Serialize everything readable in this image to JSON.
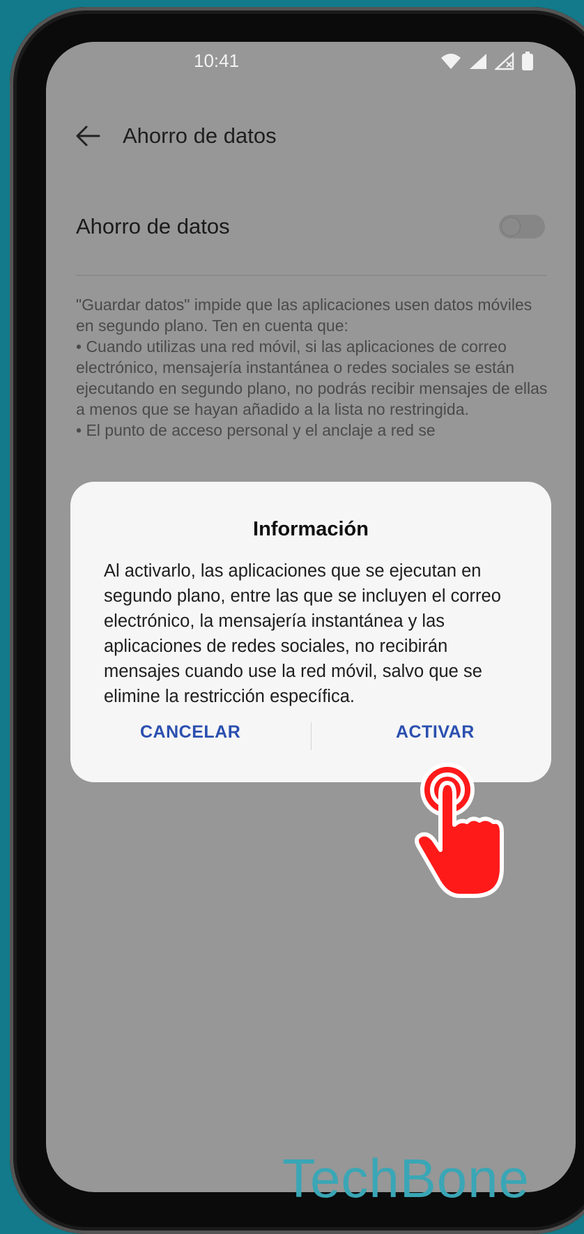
{
  "status_bar": {
    "time": "10:41",
    "icons": [
      "wifi-icon",
      "signal-icon",
      "signal-no-service-icon",
      "battery-icon"
    ]
  },
  "app_bar": {
    "title": "Ahorro de datos",
    "back_icon": "arrow-left-icon"
  },
  "setting": {
    "label": "Ahorro de datos",
    "toggle_state": "off"
  },
  "description": {
    "lines": [
      "\"Guardar datos\" impide que las aplicaciones usen datos móviles en segundo plano. Ten en cuenta que:",
      "• Cuando utilizas una red móvil, si las aplicaciones de correo electrónico, mensajería instantánea o redes sociales se están ejecutando en segundo plano, no podrás recibir mensajes de ellas a menos que se hayan añadido a la lista no restringida.",
      "• El punto de acceso personal y el anclaje a red se"
    ]
  },
  "dialog": {
    "title": "Información",
    "body": "Al activarlo, las aplicaciones que se ejecutan en segundo plano, entre las que se incluyen el correo electrónico, la mensajería instantánea y las aplicaciones de redes sociales, no recibirán mensajes cuando use la red móvil, salvo que se elimine la restricción específica.",
    "cancel_label": "CANCELAR",
    "activate_label": "ACTIVAR"
  },
  "overlay": {
    "tap_indicator_icon": "tap-hand-icon"
  },
  "watermark": "TechBone",
  "colors": {
    "background": "#127a8a",
    "dimmed_screen": "#979797",
    "dialog_button": "#2b4fb0",
    "tap_indicator": "#ff1a1a",
    "watermark": "#3aa6b5"
  }
}
